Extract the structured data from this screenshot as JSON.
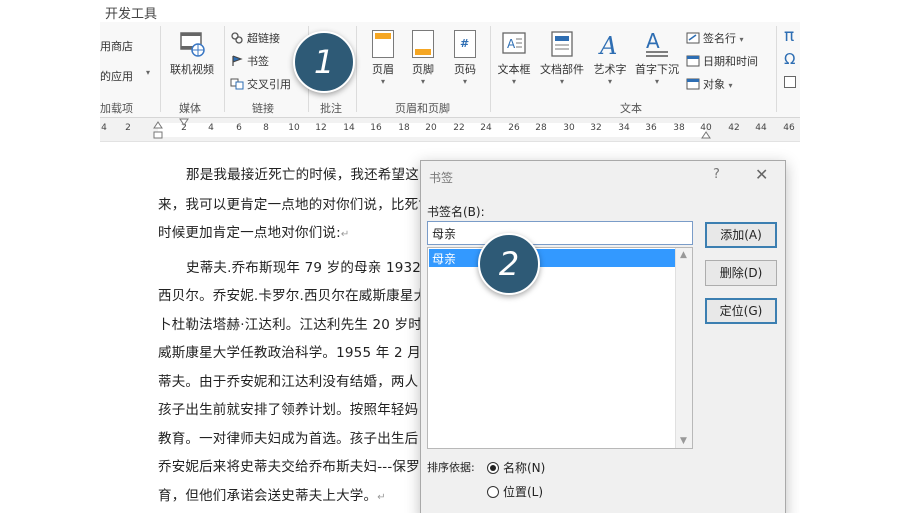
{
  "ribbon": {
    "tab": "开发工具",
    "addins_items": [
      "用商店",
      "的应用",
      "加载项"
    ],
    "groups": {
      "media": {
        "label": "媒体",
        "button": "联机视频"
      },
      "links": {
        "label": "链接",
        "items": [
          "超链接",
          "书签",
          "交叉引用"
        ]
      },
      "comments": {
        "label": "批注"
      },
      "header_footer": {
        "label": "页眉和页脚",
        "buttons": [
          "页眉",
          "页脚",
          "页码"
        ]
      },
      "text": {
        "label": "文本",
        "buttons": [
          "文本框",
          "文档部件",
          "艺术字",
          "首字下沉"
        ],
        "side": [
          "签名行",
          "日期和时间",
          "对象"
        ]
      }
    },
    "symbol_glyphs": [
      "π",
      "Ω"
    ]
  },
  "ruler": {
    "ticks": [
      "4",
      "2",
      "2",
      "4",
      "6",
      "8",
      "10",
      "12",
      "14",
      "16",
      "18",
      "20",
      "22",
      "24",
      "26",
      "28",
      "30",
      "32",
      "34",
      "36",
      "38",
      "40",
      "42",
      "44",
      "46"
    ]
  },
  "document": {
    "lines": [
      "那是我最接近死亡的时候，我还希望这",
      "来，我可以更肯定一点地的对你们说，比死亡",
      "时候更加肯定一点地对你们说:",
      "史蒂夫.乔布斯现年 79 岁的母亲 1932 年",
      "西贝尔。乔安妮.卡罗尔.西贝尔在威斯康星大",
      "卜杜勒法塔赫·江达利。江达利先生 20 岁时",
      "威斯康星大学任教政治科学。1955 年 2 月",
      "蒂夫。由于乔安妮和江达利没有结婚，两人",
      "孩子出生前就安排了领养计划。按照年轻妈",
      "教育。一对律师夫妇成为首选。孩子出生后，",
      "乔安妮后来将史蒂夫交给乔布斯夫妇---保罗",
      "育，但他们承诺会送史蒂夫上大学。"
    ],
    "paragraph_mark": "↵"
  },
  "callouts": [
    "1",
    "2"
  ],
  "dialog": {
    "title": "书签",
    "help": "?",
    "close": "✕",
    "name_label": "书签名(B):",
    "name_value": "母亲",
    "list_items": [
      "母亲"
    ],
    "buttons": {
      "add": "添加(A)",
      "delete": "删除(D)",
      "goto": "定位(G)"
    },
    "sort_label": "排序依据:",
    "sort_options": [
      {
        "label": "名称(N)",
        "selected": true
      },
      {
        "label": "位置(L)",
        "selected": false
      }
    ]
  }
}
